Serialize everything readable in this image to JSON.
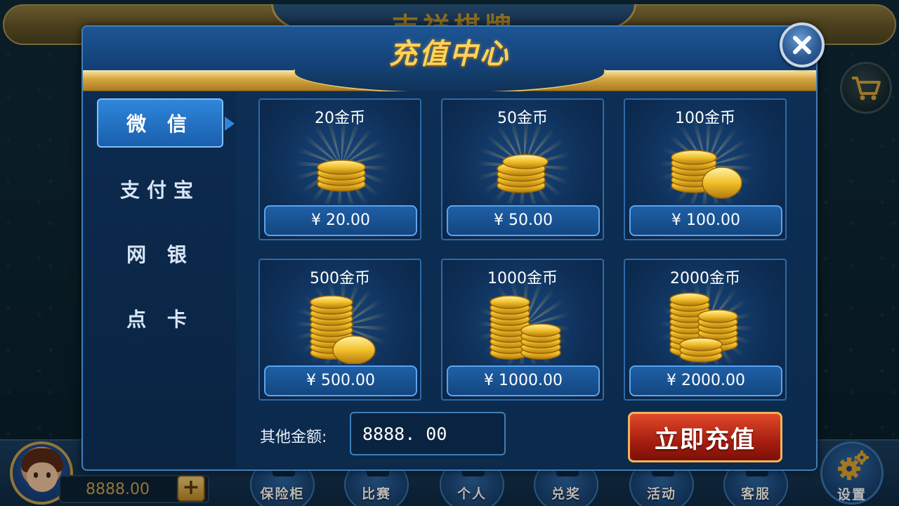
{
  "lobby": {
    "logo_text": "吉祥棋牌",
    "coins": "8888.00",
    "plus_label": "+",
    "nav": [
      "保险柜",
      "比赛",
      "个人",
      "兑奖",
      "活动",
      "客服"
    ],
    "settings_label": "设置"
  },
  "modal": {
    "title": "充值中心",
    "tabs": [
      "微 信",
      "支付宝",
      "网 银",
      "点 卡"
    ],
    "active_tab": 0,
    "packs": [
      {
        "title": "20金币",
        "price": "¥ 20.00",
        "coins": 20
      },
      {
        "title": "50金币",
        "price": "¥ 50.00",
        "coins": 50
      },
      {
        "title": "100金币",
        "price": "¥ 100.00",
        "coins": 100
      },
      {
        "title": "500金币",
        "price": "¥ 500.00",
        "coins": 500
      },
      {
        "title": "1000金币",
        "price": "¥ 1000.00",
        "coins": 1000
      },
      {
        "title": "2000金币",
        "price": "¥ 2000.00",
        "coins": 2000
      }
    ],
    "other_amount_label": "其他金额:",
    "other_amount_value": "8888. 00",
    "recharge_label": "立即充值"
  },
  "colors": {
    "gold_title": "#ffd35a",
    "panel_blue": "#0d2f55",
    "recharge_red": "#c12a16"
  }
}
